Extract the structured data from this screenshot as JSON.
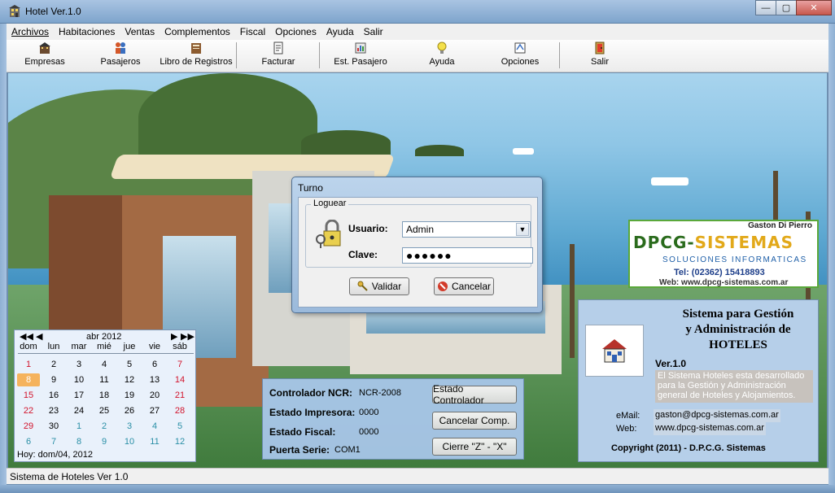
{
  "window": {
    "title": "Hotel Ver.1.0",
    "minimize": "—",
    "maximize": "▢",
    "close": "✕"
  },
  "menu": [
    {
      "label": "Archivos"
    },
    {
      "label": "Habitaciones"
    },
    {
      "label": "Ventas"
    },
    {
      "label": "Complementos"
    },
    {
      "label": "Fiscal"
    },
    {
      "label": "Opciones"
    },
    {
      "label": "Ayuda"
    },
    {
      "label": "Salir"
    }
  ],
  "toolbar": [
    {
      "label": "Empresas",
      "icon": "company-icon"
    },
    {
      "label": "Pasajeros",
      "icon": "passengers-icon"
    },
    {
      "label": "Libro de Registros",
      "icon": "register-book-icon"
    },
    {
      "label": "Facturar",
      "icon": "invoice-icon"
    },
    {
      "label": "Est. Pasajero",
      "icon": "passenger-status-icon"
    },
    {
      "label": "Ayuda",
      "icon": "help-bulb-icon"
    },
    {
      "label": "Opciones",
      "icon": "options-icon"
    },
    {
      "label": "Salir",
      "icon": "exit-door-icon"
    }
  ],
  "dialog": {
    "title": "Turno",
    "group": "Loguear",
    "user_label": "Usuario:",
    "user_value": "Admin",
    "password_label": "Clave:",
    "password_value": "●●●●●●",
    "ok_label": "Validar",
    "cancel_label": "Cancelar"
  },
  "calendar": {
    "month": "abr 2012",
    "weekdays": [
      "dom",
      "lun",
      "mar",
      "mié",
      "jue",
      "vie",
      "sáb"
    ],
    "weeks": [
      [
        "1",
        "2",
        "3",
        "4",
        "5",
        "6",
        "7"
      ],
      [
        "8",
        "9",
        "10",
        "11",
        "12",
        "13",
        "14"
      ],
      [
        "15",
        "16",
        "17",
        "18",
        "19",
        "20",
        "21"
      ],
      [
        "22",
        "23",
        "24",
        "25",
        "26",
        "27",
        "28"
      ],
      [
        "29",
        "30",
        "1",
        "2",
        "3",
        "4",
        "5"
      ],
      [
        "6",
        "7",
        "8",
        "9",
        "10",
        "11",
        "12"
      ]
    ],
    "today": "8",
    "footer": "Hoy: dom/04, 2012"
  },
  "status_panel": {
    "controller_label": "Controlador NCR:",
    "controller_value": "NCR-2008",
    "printer_label": "Estado Impresora:",
    "printer_value": "0000",
    "fiscal_label": "Estado Fiscal:",
    "fiscal_value": "0000",
    "port_label": "Puerta Serie:",
    "port_value": "COM1",
    "btn_controller": "Estado Controlador",
    "btn_cancel": "Cancelar Comp.",
    "btn_close": "Cierre \"Z\" - \"X\""
  },
  "info": {
    "title_1": "Sistema para Gestión",
    "title_2": "y Administración de",
    "title_3": "HOTELES",
    "version": "Ver.1.0",
    "description": "El Sistema Hoteles esta desarrollado para la Gestión y Administración general de Hoteles y Alojamientos.",
    "email_label": "eMail:",
    "email_value": "gaston@dpcg-sistemas.com.ar",
    "web_label": "Web:",
    "web_value": "www.dpcg-sistemas.com.ar",
    "copyright": "Copyright (2011) - D.P.C.G. Sistemas"
  },
  "brand": {
    "author": "Gaston Di Pierro",
    "name_1": "DPCG-",
    "name_2": "SISTEMAS",
    "tagline": "SOLUCIONES INFORMATICAS",
    "phone": "Tel: (02362) 15418893",
    "web": "Web: www.dpcg-sistemas.com.ar"
  },
  "statusbar": {
    "text": "Sistema de Hoteles Ver 1.0"
  },
  "colors": {
    "title_bar": "#7ea4cc",
    "panel": "#b6cfe9",
    "calendar_weekend": "#d2142c",
    "today_highlight": "#f5b35d"
  }
}
